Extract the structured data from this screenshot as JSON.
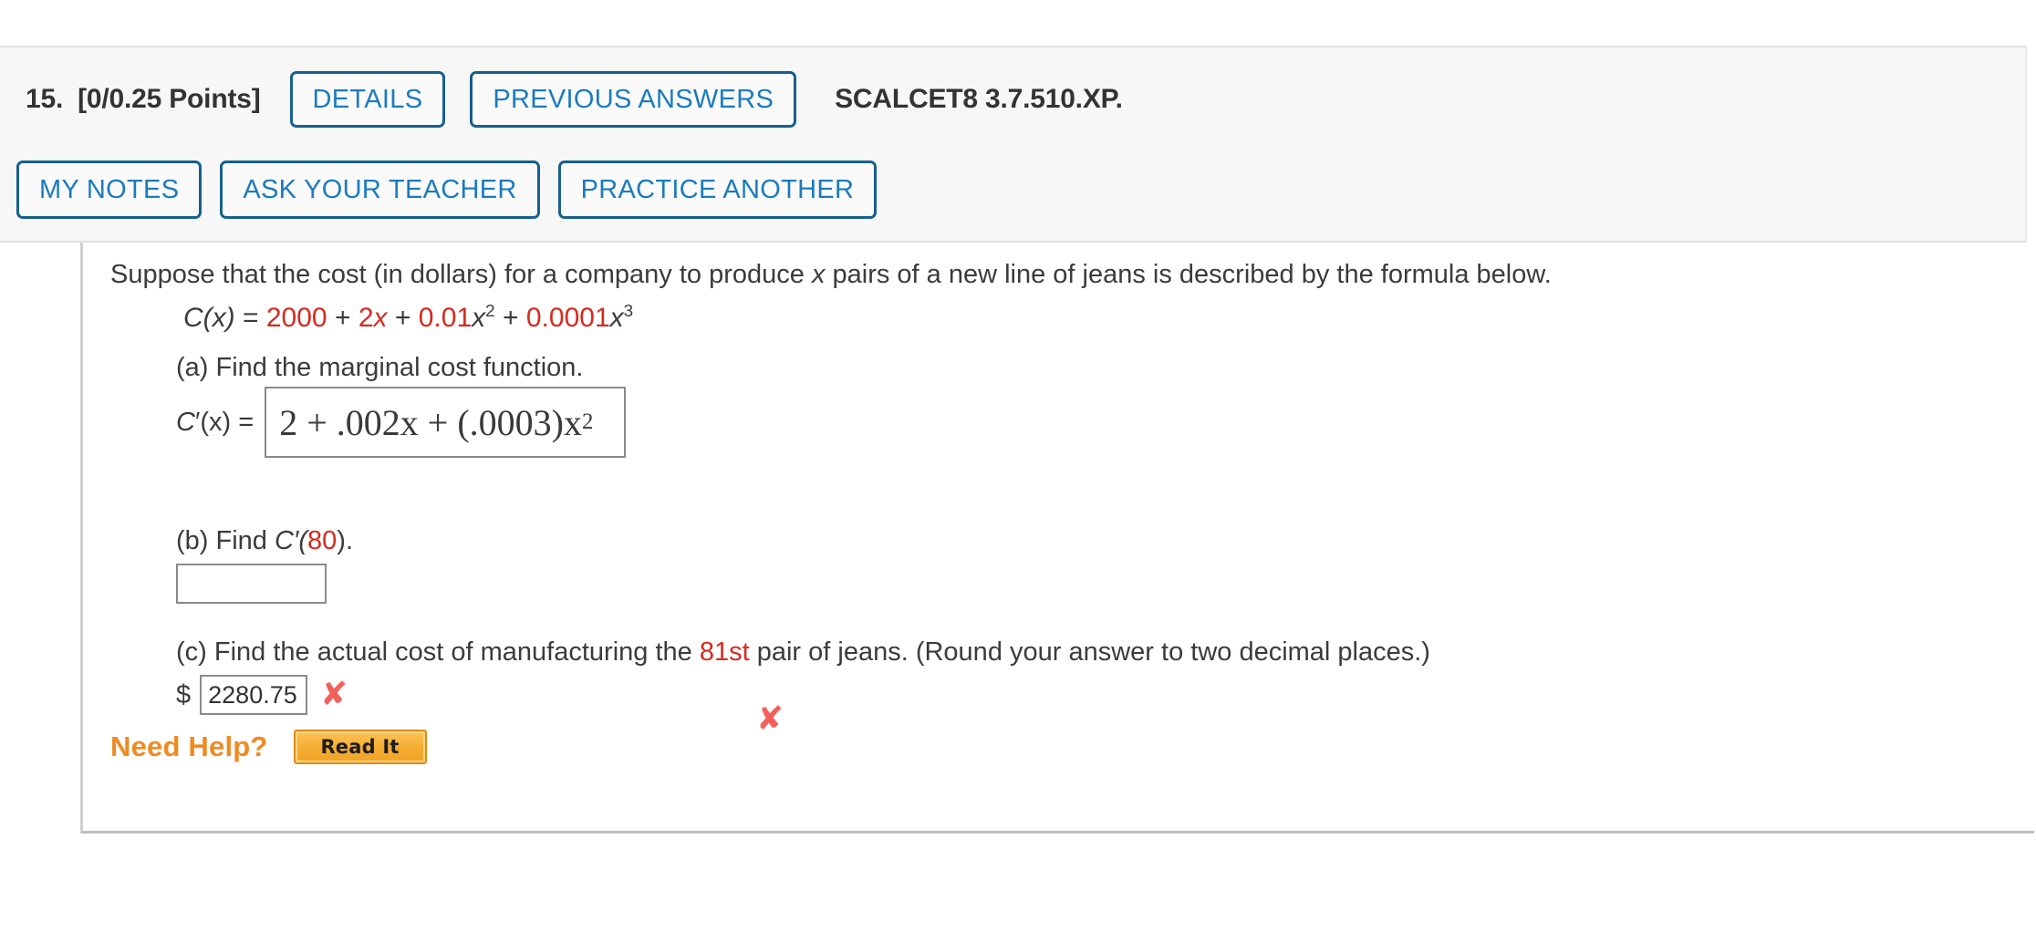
{
  "header": {
    "question_number": "15.",
    "points": "[0/0.25 Points]",
    "details_label": "DETAILS",
    "previous_answers_label": "PREVIOUS ANSWERS",
    "problem_code": "SCALCET8 3.7.510.XP.",
    "my_notes_label": "MY NOTES",
    "ask_your_teacher_label": "ASK YOUR TEACHER",
    "practice_another_label": "PRACTICE ANOTHER"
  },
  "problem": {
    "stem_before_x": "Suppose that the cost (in dollars) for a company to produce ",
    "stem_var": "x",
    "stem_after_x": " pairs of a new line of jeans is described by the formula below.",
    "formula": {
      "lhs": "C(x)",
      "equals": "=",
      "term_constant": "2000",
      "plus1": "+",
      "term_linear_coef": "2",
      "term_linear_var": "x",
      "plus2": "+",
      "term_quad_coef": "0.01",
      "term_quad_var": "x",
      "term_quad_exp": "2",
      "plus3": "+",
      "term_cubic_coef": "0.0001",
      "term_cubic_var": "x",
      "term_cubic_exp": "3"
    },
    "parts": {
      "a": {
        "prompt": "(a) Find the marginal cost function.",
        "answer_label_c": "C",
        "answer_label_prime": "′(x) =",
        "answer_value_main": "2 + .002x + (.0003)x",
        "answer_value_exp": "2",
        "status": "incorrect",
        "status_icon": "x-mark-icon"
      },
      "b": {
        "prompt_before": "(b) Find ",
        "prompt_func": "C′(",
        "prompt_value": "80",
        "prompt_after": ").",
        "answer_value": "",
        "placeholder": ""
      },
      "c": {
        "prompt_before": "(c) Find the actual cost of manufacturing the ",
        "prompt_value": "81st",
        "prompt_after": " pair of jeans. (Round your answer to two decimal places.)",
        "currency_symbol": "$",
        "answer_value": "2280.75",
        "status": "incorrect",
        "status_icon": "x-mark-icon"
      }
    }
  },
  "help": {
    "label": "Need Help?",
    "read_it_label": "Read It"
  },
  "colors": {
    "accent_blue": "#1b7bbd",
    "button_border": "#17608e",
    "red_value": "#d62a1e",
    "incorrect_red": "#f4605c",
    "help_orange": "#ef8b22",
    "header_bg": "#f7f7f7"
  }
}
